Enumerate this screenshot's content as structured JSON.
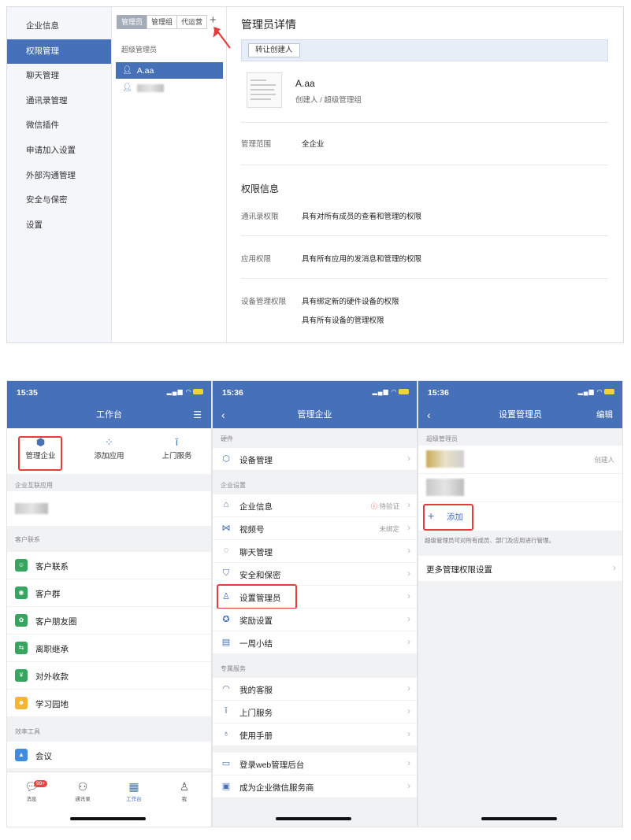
{
  "desktop": {
    "nav": [
      "企业信息",
      "权限管理",
      "聊天管理",
      "通讯录管理",
      "微信插件",
      "申请加入设置",
      "外部沟通管理",
      "安全与保密",
      "设置"
    ],
    "nav_active": 1,
    "tabs": [
      "管理员",
      "管理组",
      "代运营"
    ],
    "plus": "+",
    "group_title": "超级管理员",
    "person_selected": "A.aa",
    "detail_title": "管理员详情",
    "transfer_btn": "转让创建人",
    "name": "A.aa",
    "role": "创建人 / 超级管理组",
    "scope_label": "管理范围",
    "scope_value": "全企业",
    "perm_title": "权限信息",
    "perm_contacts_label": "通讯录权限",
    "perm_contacts_value": "具有对所有成员的查看和管理的权限",
    "perm_apps_label": "应用权限",
    "perm_apps_value": "具有所有应用的发消息和管理的权限",
    "perm_device_label": "设备管理权限",
    "perm_device_value1": "具有绑定新的硬件设备的权限",
    "perm_device_value2": "具有所有设备的管理权限"
  },
  "phone1": {
    "time": "15:35",
    "title": "工作台",
    "top_buttons": [
      "管理企业",
      "添加应用",
      "上门服务"
    ],
    "sec_interconnect": "企业互联应用",
    "sec_customer": "客户联系",
    "customer_apps": [
      "客户联系",
      "客户群",
      "客户朋友圈",
      "离职继承",
      "对外收款",
      "学习园地"
    ],
    "sec_efficiency": "效率工具",
    "efficiency_apps": [
      "会议"
    ],
    "tabs": [
      "消息",
      "通讯录",
      "工作台",
      "我"
    ],
    "badge": "99+"
  },
  "phone2": {
    "time": "15:36",
    "title": "管理企业",
    "sec_hardware": "硬件",
    "hardware": [
      "设备管理"
    ],
    "sec_settings": "企业设置",
    "settings": [
      "企业信息",
      "视频号",
      "聊天管理",
      "安全和保密",
      "设置管理员",
      "奖励设置",
      "一周小结"
    ],
    "enterprise_info_status": "待验证",
    "video_status": "未绑定",
    "sec_service": "专属服务",
    "service": [
      "我的客服",
      "上门服务",
      "使用手册"
    ],
    "extra": [
      "登录web管理后台",
      "成为企业微信服务商"
    ]
  },
  "phone3": {
    "time": "15:36",
    "title": "设置管理员",
    "edit": "编辑",
    "sec_super": "超级管理员",
    "creator_tag": "创建人",
    "add": "添加",
    "note": "超级管理员可对所有成员、部门及应用进行管理。",
    "more": "更多管理权限设置"
  }
}
